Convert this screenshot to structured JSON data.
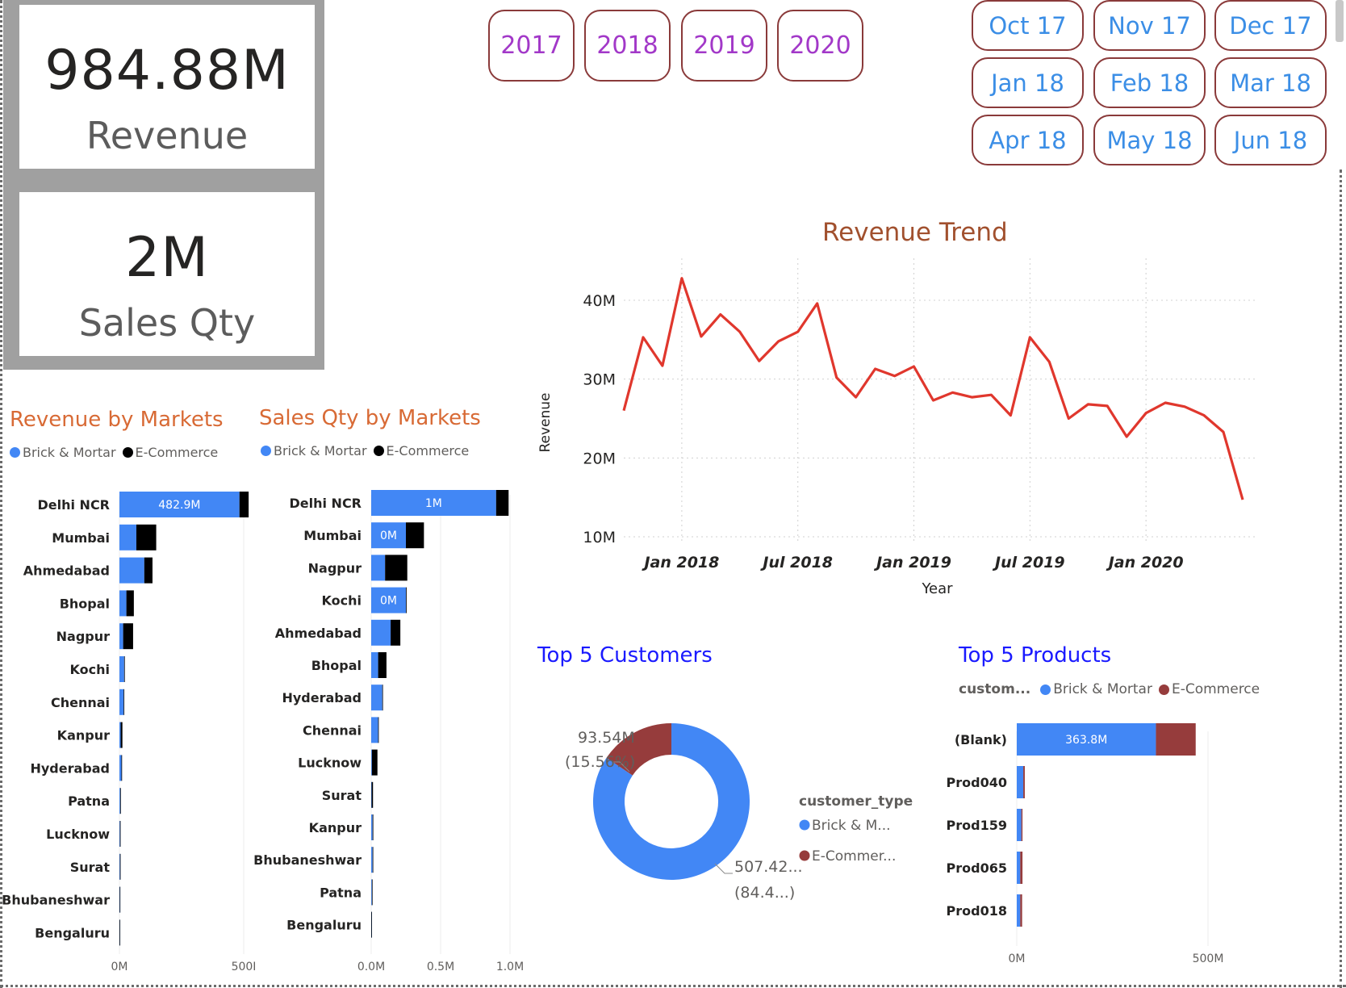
{
  "kpis": {
    "revenue_value": "984.88M",
    "revenue_label": "Revenue",
    "qty_value": "2M",
    "qty_label": "Sales Qty"
  },
  "year_slicer": [
    "2017",
    "2018",
    "2019",
    "2020"
  ],
  "month_slicer": [
    "Oct 17",
    "Nov 17",
    "Dec 17",
    "Jan 18",
    "Feb 18",
    "Mar 18",
    "Apr 18",
    "May 18",
    "Jun 18"
  ],
  "colors": {
    "brick": "#4287f5",
    "ecommerce_markets": "#000000",
    "ecommerce_other": "#963c3c",
    "trend_line": "#e0372d",
    "title_orange": "#d86a35",
    "title_brown": "#a1502e",
    "title_blue": "#1a1aff"
  },
  "chart_data": [
    {
      "type": "bar",
      "orientation": "horizontal",
      "stacked": true,
      "title": "Revenue by Markets",
      "legend": [
        "Brick & Mortar",
        "E-Commerce"
      ],
      "legend_placement": "top-left",
      "categories": [
        "Delhi NCR",
        "Mumbai",
        "Ahmedabad",
        "Bhopal",
        "Nagpur",
        "Kochi",
        "Chennai",
        "Kanpur",
        "Hyderabad",
        "Patna",
        "Lucknow",
        "Surat",
        "Bhubaneshwar",
        "Bengaluru"
      ],
      "series": [
        {
          "name": "Brick & Mortar",
          "values": [
            482.9,
            68,
            100,
            28,
            15,
            19,
            17,
            5,
            8,
            3,
            2,
            2,
            1,
            0.4
          ]
        },
        {
          "name": "E-Commerce",
          "values": [
            37,
            80,
            33,
            30,
            40,
            1,
            1,
            7,
            0.5,
            1,
            1,
            0.5,
            0.3,
            0.1
          ]
        }
      ],
      "data_labels": [
        "482.9M"
      ],
      "xticks": [
        "0M",
        "500I"
      ],
      "xlim": [
        0,
        500
      ]
    },
    {
      "type": "bar",
      "orientation": "horizontal",
      "stacked": true,
      "title": "Sales Qty by Markets",
      "legend": [
        "Brick & Mortar",
        "E-Commerce"
      ],
      "legend_placement": "top-left",
      "categories": [
        "Delhi NCR",
        "Mumbai",
        "Nagpur",
        "Kochi",
        "Ahmedabad",
        "Bhopal",
        "Hyderabad",
        "Chennai",
        "Lucknow",
        "Surat",
        "Kanpur",
        "Bhubaneshwar",
        "Patna",
        "Bengaluru"
      ],
      "series": [
        {
          "name": "Brick & Mortar",
          "values": [
            0.9,
            0.25,
            0.1,
            0.25,
            0.14,
            0.05,
            0.08,
            0.05,
            0.005,
            0.003,
            0.01,
            0.01,
            0.005,
            0.001
          ]
        },
        {
          "name": "E-Commerce",
          "values": [
            0.09,
            0.13,
            0.16,
            0.005,
            0.07,
            0.06,
            0.001,
            0.001,
            0.04,
            0.01,
            0.005,
            0.001,
            0.001,
            0.0005
          ]
        }
      ],
      "data_labels": [
        "1M",
        "0M",
        "",
        "0M"
      ],
      "xticks": [
        "0.0M",
        "0.5M",
        "1.0M"
      ],
      "xlim": [
        0,
        1.0
      ]
    },
    {
      "type": "line",
      "title": "Revenue Trend",
      "xlabel": "Year",
      "ylabel": "Revenue",
      "x": [
        "2017-10",
        "2017-11",
        "2017-12",
        "2018-01",
        "2018-02",
        "2018-03",
        "2018-04",
        "2018-05",
        "2018-06",
        "2018-07",
        "2018-08",
        "2018-09",
        "2018-10",
        "2018-11",
        "2018-12",
        "2019-01",
        "2019-02",
        "2019-03",
        "2019-04",
        "2019-05",
        "2019-06",
        "2019-07",
        "2019-08",
        "2019-09",
        "2019-10",
        "2019-11",
        "2019-12",
        "2020-01",
        "2020-02",
        "2020-03",
        "2020-04",
        "2020-05",
        "2020-06"
      ],
      "values": [
        26,
        35.3,
        31.7,
        42.8,
        35.4,
        38.2,
        36,
        32.3,
        34.8,
        36,
        39.6,
        30.2,
        27.7,
        31.3,
        30.4,
        31.6,
        27.3,
        28.3,
        27.7,
        28,
        25.4,
        35.3,
        32.2,
        25,
        26.8,
        26.6,
        22.7,
        25.7,
        27,
        26.5,
        25.4,
        23.3,
        14.7
      ],
      "xticks": [
        "Jan 2018",
        "Jul 2018",
        "Jan 2019",
        "Jul 2019",
        "Jan 2020"
      ],
      "yticks": [
        "10M",
        "20M",
        "30M",
        "40M"
      ],
      "ylim": [
        10,
        45
      ],
      "grid": true
    },
    {
      "type": "pie",
      "donut": true,
      "title": "Top 5 Customers",
      "legend_title": "customer_type",
      "legend": [
        "Brick & M...",
        "E-Commer..."
      ],
      "legend_placement": "right",
      "slices": [
        {
          "name": "Brick & Mortar",
          "value": 507.42,
          "label_value": "507.42...",
          "label_pct": "(84.4...)"
        },
        {
          "name": "E-Commerce",
          "value": 93.54,
          "label_value": "93.54M",
          "label_pct": "(15.56%)"
        }
      ]
    },
    {
      "type": "bar",
      "orientation": "horizontal",
      "stacked": true,
      "title": "Top 5 Products",
      "legend_title": "custom...",
      "legend": [
        "Brick & Mortar",
        "E-Commerce"
      ],
      "legend_placement": "top",
      "categories": [
        "(Blank)",
        "Prod040",
        "Prod159",
        "Prod065",
        "Prod018"
      ],
      "series": [
        {
          "name": "Brick & Mortar",
          "values": [
            363.8,
            17,
            12,
            9,
            9
          ]
        },
        {
          "name": "E-Commerce",
          "values": [
            104,
            4,
            3,
            6,
            5
          ]
        }
      ],
      "data_labels": [
        "363.8M"
      ],
      "xticks": [
        "0M",
        "500M"
      ],
      "xlim": [
        0,
        500
      ]
    }
  ]
}
